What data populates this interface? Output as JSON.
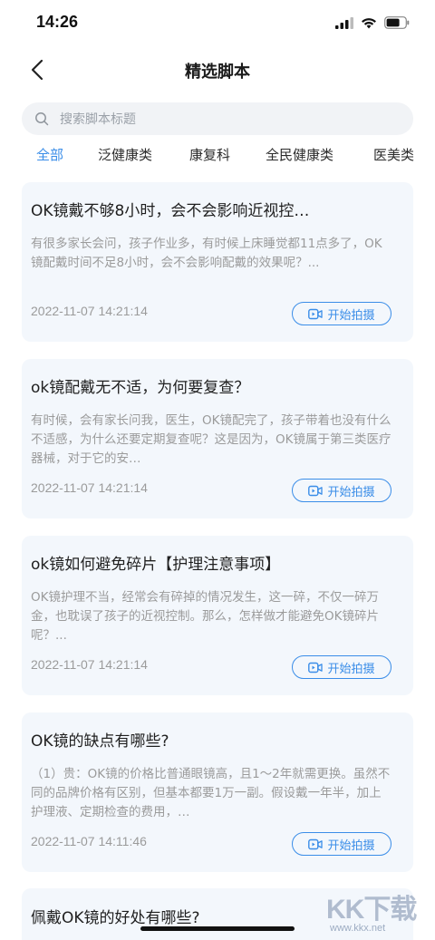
{
  "status_bar": {
    "time": "14:26"
  },
  "nav": {
    "title": "精选脚本"
  },
  "search": {
    "placeholder": "搜索脚本标题"
  },
  "tabs": [
    {
      "label": "全部",
      "active": true
    },
    {
      "label": "泛健康类",
      "active": false
    },
    {
      "label": "康复科",
      "active": false
    },
    {
      "label": "全民健康类",
      "active": false
    },
    {
      "label": "医美类",
      "active": false
    }
  ],
  "cards": [
    {
      "title": "OK镜戴不够8小时，会不会影响近视控…",
      "desc": "有很多家长会问，孩子作业多，有时候上床睡觉都11点多了，OK镜配戴时间不足8小时，会不会影响配戴的效果呢？...",
      "date": "2022-11-07 14:21:14",
      "button": "开始拍摄"
    },
    {
      "title": "ok镜配戴无不适，为何要复查？",
      "desc": "有时候，会有家长问我，医生，OK镜配完了，孩子带着也没有什么不适感，为什么还要定期复查呢？这是因为，OK镜属于第三类医疗器械，对于它的安…",
      "date": "2022-11-07 14:21:14",
      "button": "开始拍摄"
    },
    {
      "title": "ok镜如何避免碎片【护理注意事项】",
      "desc": "OK镜护理不当，经常会有碎掉的情况发生，这一碎，不仅一碎万金，也耽误了孩子的近视控制。那么，怎样做才能避免OK镜碎片呢？...",
      "date": "2022-11-07 14:21:14",
      "button": "开始拍摄"
    },
    {
      "title": "OK镜的缺点有哪些?",
      "desc": "（1）贵：OK镜的价格比普通眼镜高，且1～2年就需更换。虽然不同的品牌价格有区别，但基本都要1万一副。假设戴一年半，加上护理液、定期检查的费用，…",
      "date": "2022-11-07 14:11:46",
      "button": "开始拍摄"
    },
    {
      "title": "佩戴OK镜的好处有哪些?"
    }
  ],
  "watermark": {
    "logo": "KK下载",
    "url": "www.kkx.net"
  },
  "colors": {
    "accent": "#3a8de8",
    "card_bg": "#f3f7fc",
    "muted": "#9b9b9b"
  }
}
